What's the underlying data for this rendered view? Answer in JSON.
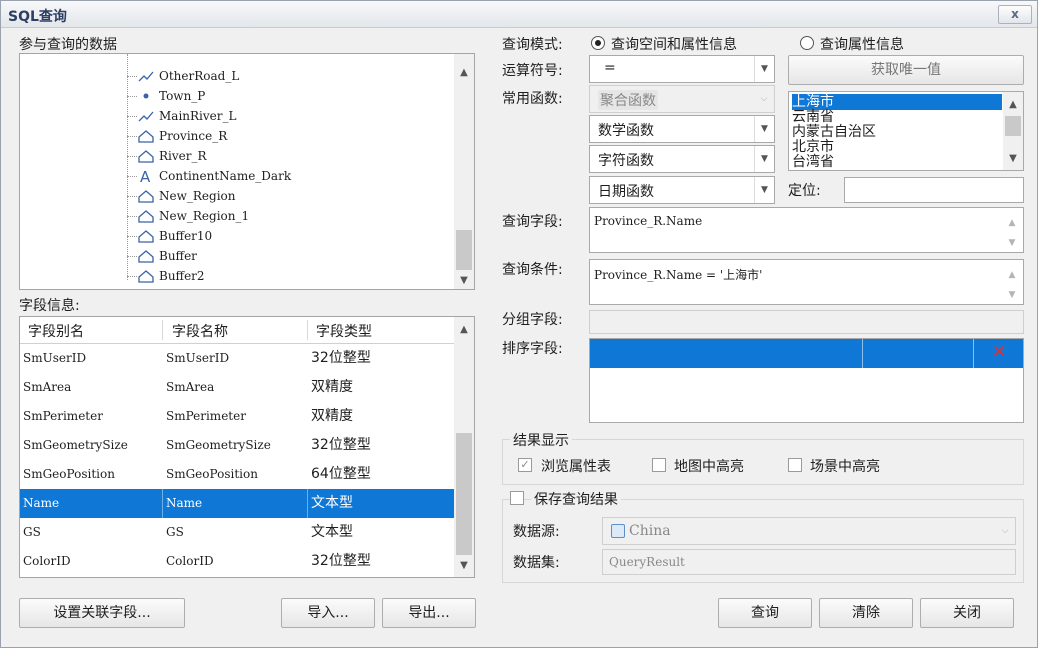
{
  "window": {
    "title": "SQL查询",
    "close_label": "x"
  },
  "left": {
    "data_label": "参与查询的数据",
    "tree_items": [
      {
        "name": "OtherRoad_L",
        "icon": "line-icon"
      },
      {
        "name": "Town_P",
        "icon": "point-icon"
      },
      {
        "name": "MainRiver_L",
        "icon": "line-icon"
      },
      {
        "name": "Province_R",
        "icon": "region-icon"
      },
      {
        "name": "River_R",
        "icon": "region-icon"
      },
      {
        "name": "ContinentName_Dark",
        "icon": "text-icon"
      },
      {
        "name": "New_Region",
        "icon": "region-icon"
      },
      {
        "name": "New_Region_1",
        "icon": "region-icon"
      },
      {
        "name": "Buffer10",
        "icon": "region-icon"
      },
      {
        "name": "Buffer",
        "icon": "region-icon"
      },
      {
        "name": "Buffer2",
        "icon": "region-icon"
      }
    ],
    "field_info_label": "字段信息:",
    "grid_headers": [
      "字段别名",
      "字段名称",
      "字段类型"
    ],
    "grid_rows": [
      [
        "SmUserID",
        "SmUserID",
        "32位整型"
      ],
      [
        "SmArea",
        "SmArea",
        "双精度"
      ],
      [
        "SmPerimeter",
        "SmPerimeter",
        "双精度"
      ],
      [
        "SmGeometrySize",
        "SmGeometrySize",
        "32位整型"
      ],
      [
        "SmGeoPosition",
        "SmGeoPosition",
        "64位整型"
      ],
      [
        "Name",
        "Name",
        "文本型"
      ],
      [
        "GS",
        "GS",
        "文本型"
      ],
      [
        "ColorID",
        "ColorID",
        "32位整型"
      ]
    ],
    "selected_row": 5,
    "set_related_button": "设置关联字段...",
    "import_button": "导入...",
    "export_button": "导出..."
  },
  "right": {
    "query_mode_label": "查询模式:",
    "mode_spatial": "查询空间和属性信息",
    "mode_attr": "查询属性信息",
    "mode_selected": "spatial",
    "operator_label": "运算符号:",
    "operator_value": "=",
    "get_unique_button": "获取唯一值",
    "functions_label": "常用函数:",
    "func_aggregate": "聚合函数",
    "func_math": "数学函数",
    "func_string": "字符函数",
    "func_date": "日期函数",
    "unique_values": [
      "上海市",
      "云南省",
      "内蒙古自治区",
      "北京市",
      "台湾省"
    ],
    "locate_label": "定位:",
    "locate_value": "",
    "query_field_label": "查询字段:",
    "query_field_value": "Province_R.Name",
    "query_condition_label": "查询条件:",
    "query_condition_value": "Province_R.Name = '上海市'",
    "group_field_label": "分组字段:",
    "sort_field_label": "排序字段:",
    "result_display_label": "结果显示",
    "browse_attr_label": "浏览属性表",
    "browse_attr_checked": true,
    "map_highlight_label": "地图中高亮",
    "scene_highlight_label": "场景中高亮",
    "save_result_label": "保存查询结果",
    "datasource_label": "数据源:",
    "datasource_value": "China",
    "dataset_label": "数据集:",
    "dataset_value": "QueryResult",
    "query_button": "查询",
    "clear_button": "清除",
    "close_button": "关闭"
  },
  "colors": {
    "selection": "#0f78d7",
    "delete_icon": "#e0302a"
  }
}
